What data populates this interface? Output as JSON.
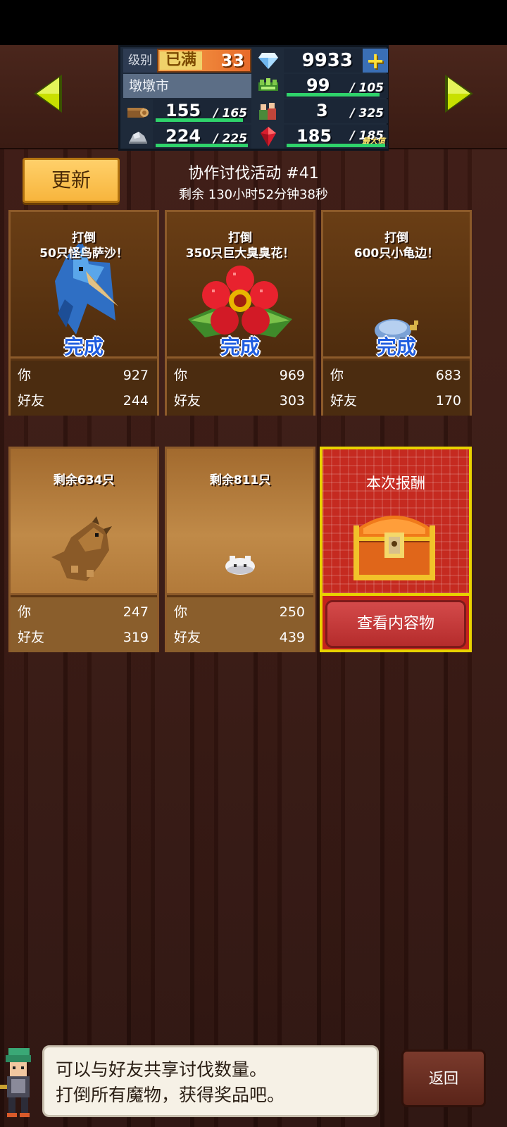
{
  "hud": {
    "level_label": "级别",
    "level_max_label": "已满",
    "level_value": "33",
    "gems": "9933",
    "town_name": "墩墩市",
    "resources": [
      {
        "icon": "wood-icon",
        "current": "155",
        "max": "165",
        "fill": 0.94
      },
      {
        "icon": "stone-icon",
        "current": "224",
        "max": "225",
        "fill": 0.99
      },
      {
        "icon": "grass-icon",
        "current": "99",
        "max": "105",
        "fill": 0.94
      },
      {
        "icon": "residents-icon",
        "current": "3",
        "max": "325",
        "fill": 0.01
      },
      {
        "icon": "ruby-icon",
        "current": "185",
        "max": "185",
        "fill": 1.0,
        "tag": "最大值"
      }
    ],
    "separator": "/"
  },
  "event": {
    "refresh_label": "更新",
    "title": "协作讨伐活动 #41",
    "remaining": "剩余 130小时52分钟38秒"
  },
  "cards": [
    {
      "task_line1": "打倒",
      "task_line2": "50只怪鸟萨沙！",
      "status": "完成",
      "monster": "blue-bird-monster",
      "you_label": "你",
      "you": "927",
      "friend_label": "好友",
      "friend": "244"
    },
    {
      "task_line1": "打倒",
      "task_line2": "350只巨大臭臭花！",
      "status": "完成",
      "monster": "red-flower-monster",
      "you_label": "你",
      "you": "969",
      "friend_label": "好友",
      "friend": "303"
    },
    {
      "task_line1": "打倒",
      "task_line2": "600只小龟边！",
      "status": "完成",
      "monster": "turtle-monster",
      "you_label": "你",
      "you": "683",
      "friend_label": "好友",
      "friend": "170"
    },
    {
      "task_line1": "剩余634只",
      "task_line2": "",
      "status": "",
      "monster": "brown-dragon-monster",
      "you_label": "你",
      "you": "247",
      "friend_label": "好友",
      "friend": "319"
    },
    {
      "task_line1": "剩余811只",
      "task_line2": "",
      "status": "",
      "monster": "white-bunny-monster",
      "you_label": "你",
      "you": "250",
      "friend_label": "好友",
      "friend": "439"
    }
  ],
  "reward": {
    "title": "本次报酬",
    "view_label": "查看内容物"
  },
  "message": {
    "line1": "可以与好友共享讨伐数量。",
    "line2": "打倒所有魔物，获得奖品吧。"
  },
  "back_label": "返回",
  "colors": {
    "accent_yellow": "#c8e000",
    "done_blue": "#1f5de0",
    "bar_green": "#2fd36b",
    "reward_red": "#c4231c"
  }
}
